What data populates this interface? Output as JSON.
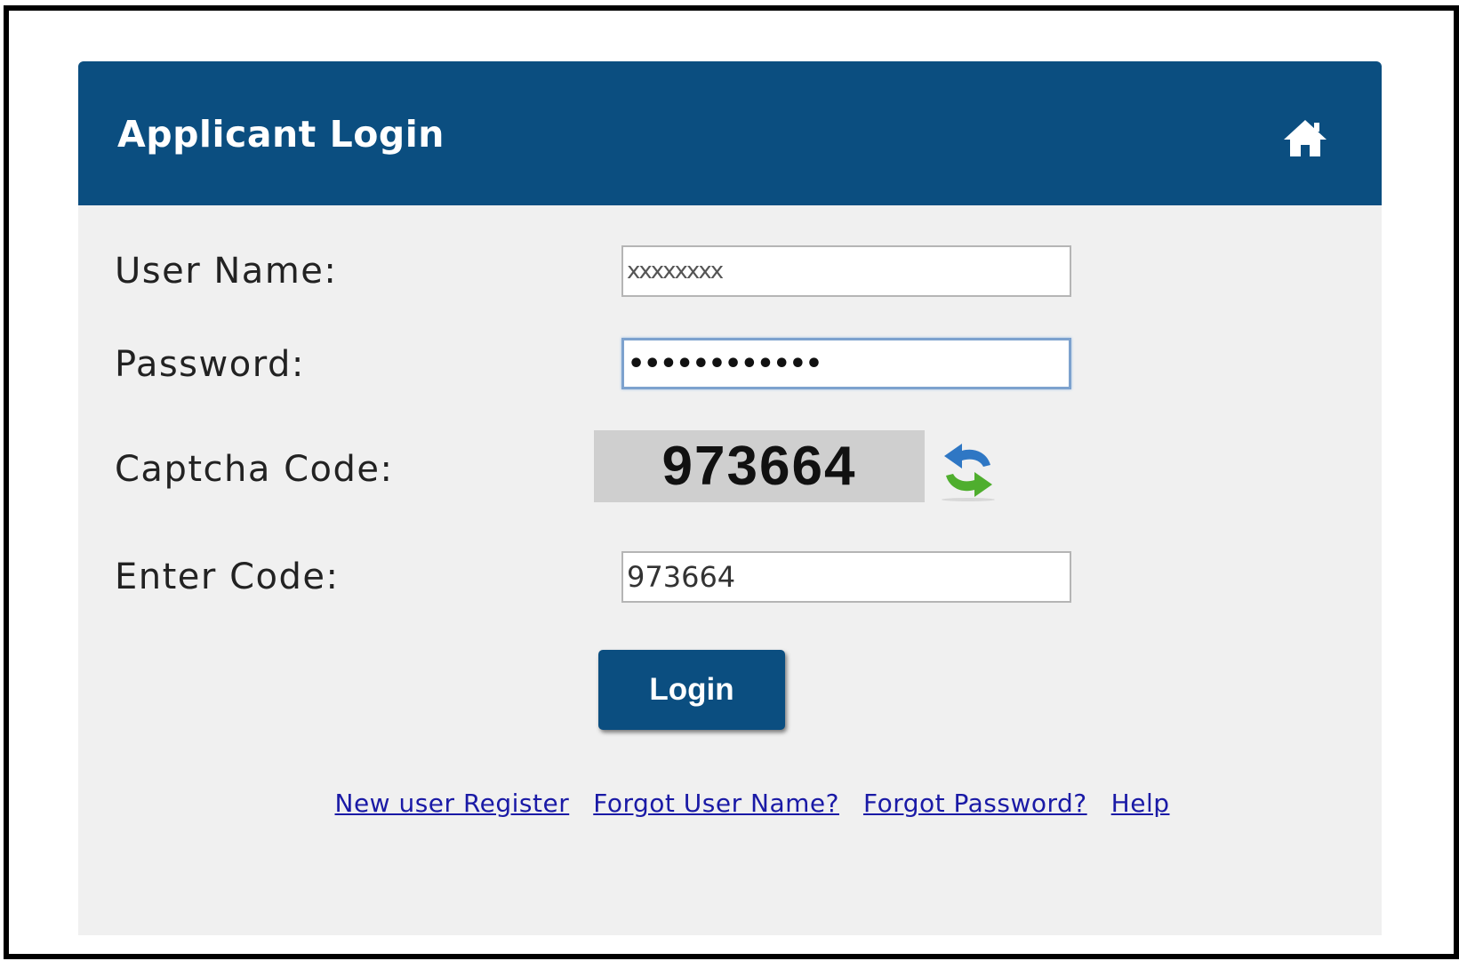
{
  "form": {
    "title": "Applicant Login",
    "home_icon": "home-icon",
    "username_label": "User Name:",
    "username_value": "xxxxxxxx",
    "password_label": "Password:",
    "password_value": "••••••••••••",
    "captcha_label": "Captcha Code:",
    "captcha_code": "973664",
    "refresh_icon": "refresh-icon",
    "enter_code_label": "Enter Code:",
    "enter_code_value": "973664",
    "login_label": "Login"
  },
  "links": [
    {
      "label": "New user Register"
    },
    {
      "label": "Forgot User Name?"
    },
    {
      "label": "Forgot Password?"
    },
    {
      "label": "Help"
    }
  ],
  "colors": {
    "header": "#0b4e80",
    "panel_bg": "#f0f0f0",
    "link": "#1a1aa6",
    "captcha_bg": "#cfcfcf"
  }
}
